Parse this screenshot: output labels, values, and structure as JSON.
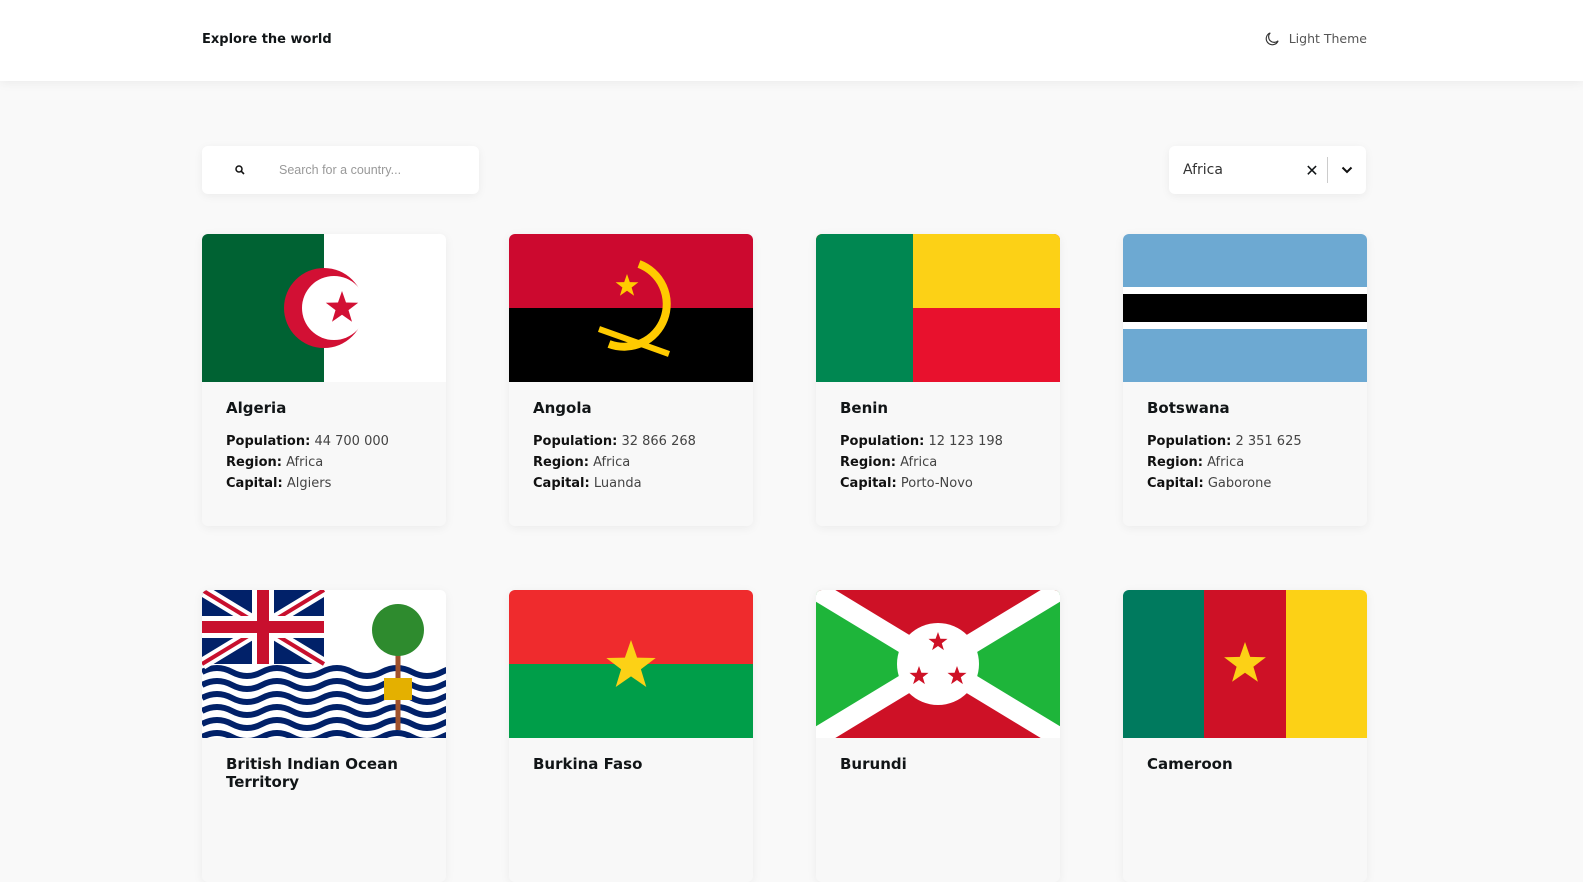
{
  "header": {
    "title": "Explore the world",
    "theme_label": "Light Theme",
    "theme_icon": "moon-icon"
  },
  "search": {
    "placeholder": "Search for a country...",
    "value": "",
    "icon": "search-icon"
  },
  "filter": {
    "selected": "Africa",
    "clear_icon": "close-icon",
    "dropdown_icon": "chevron-down-icon"
  },
  "labels": {
    "population": "Population:",
    "region": "Region:",
    "capital": "Capital:"
  },
  "countries": [
    {
      "name": "Algeria",
      "population": "44 700 000",
      "region": "Africa",
      "capital": "Algiers",
      "flag": "algeria"
    },
    {
      "name": "Angola",
      "population": "32 866 268",
      "region": "Africa",
      "capital": "Luanda",
      "flag": "angola"
    },
    {
      "name": "Benin",
      "population": "12 123 198",
      "region": "Africa",
      "capital": "Porto-Novo",
      "flag": "benin"
    },
    {
      "name": "Botswana",
      "population": "2 351 625",
      "region": "Africa",
      "capital": "Gaborone",
      "flag": "botswana"
    },
    {
      "name": "British Indian Ocean Territory",
      "flag": "biot"
    },
    {
      "name": "Burkina Faso",
      "flag": "burkina-faso"
    },
    {
      "name": "Burundi",
      "flag": "burundi"
    },
    {
      "name": "Cameroon",
      "flag": "cameroon"
    }
  ]
}
